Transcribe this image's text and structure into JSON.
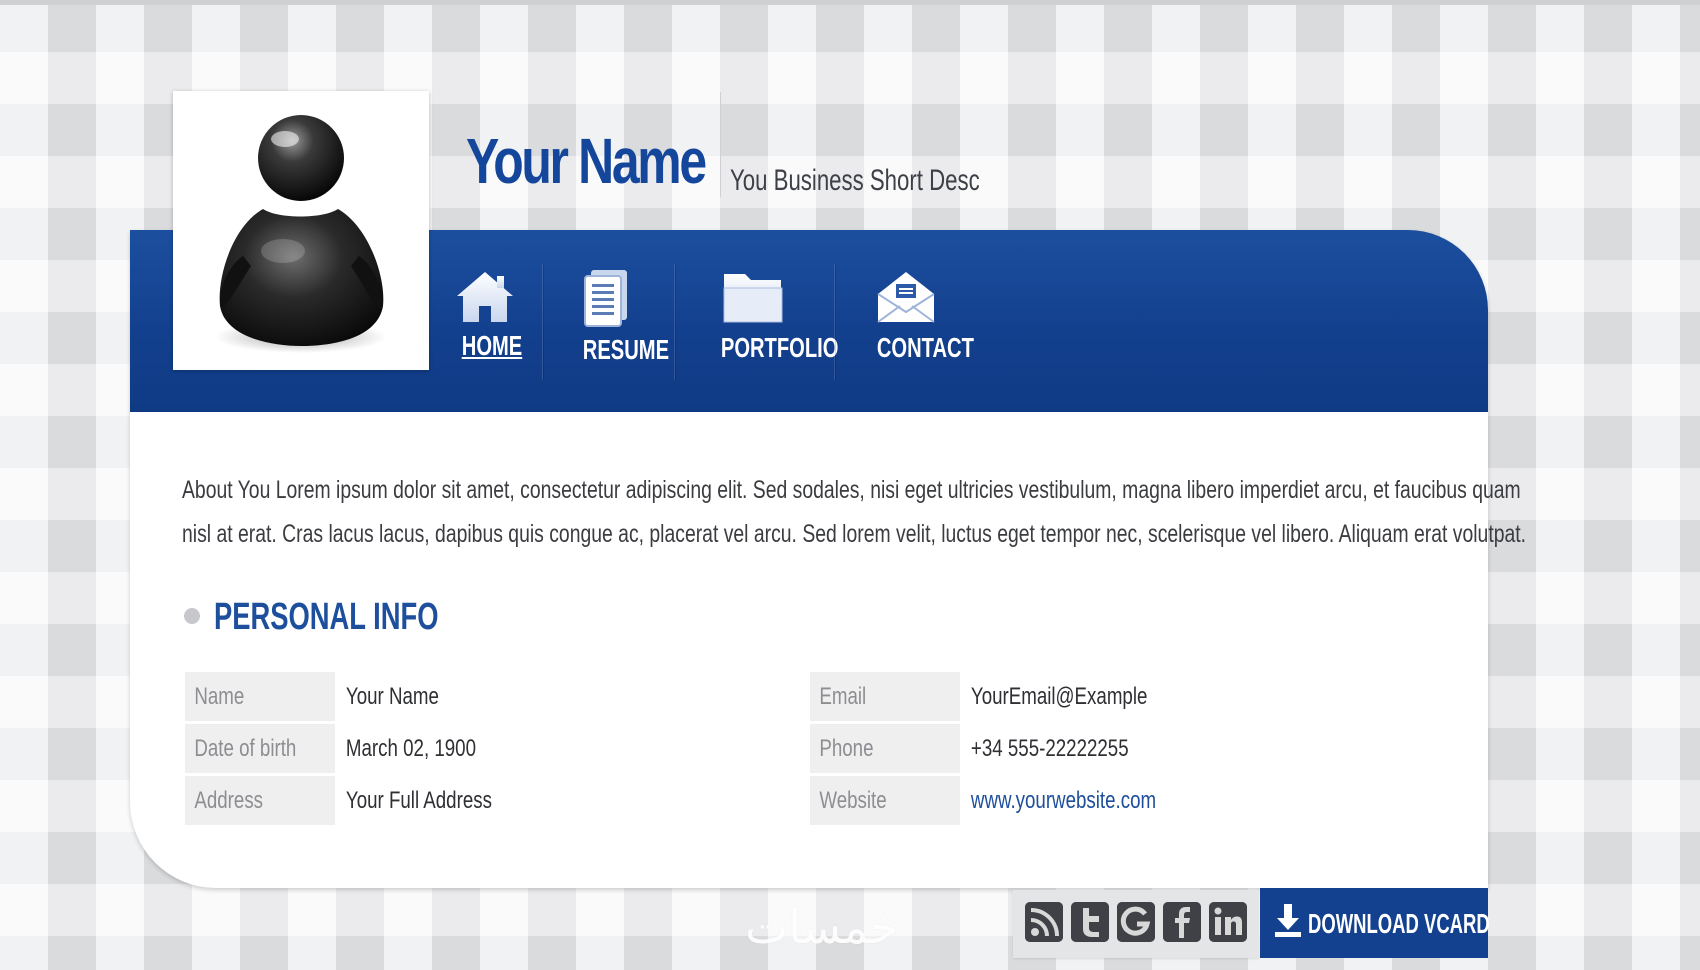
{
  "header": {
    "name": "Your Name",
    "short_desc": "You Business Short Desc"
  },
  "avatar": {
    "icon": "person-silhouette-icon"
  },
  "nav": {
    "items": [
      {
        "label": "HOME",
        "icon": "home-icon",
        "active": true
      },
      {
        "label": "RESUME",
        "icon": "document-icon",
        "active": false
      },
      {
        "label": "PORTFOLIO",
        "icon": "folder-icon",
        "active": false
      },
      {
        "label": "CONTACT",
        "icon": "envelope-icon",
        "active": false
      }
    ]
  },
  "about": {
    "line1": "About You Lorem ipsum dolor sit amet, consectetur adipiscing elit. Sed sodales, nisi eget ultricies vestibulum, magna libero imperdiet arcu, et faucibus quam",
    "line2": "nisl at erat. Cras lacus lacus, dapibus quis congue ac, placerat vel arcu. Sed lorem velit, luctus eget tempor nec, scelerisque vel libero. Aliquam erat volutpat."
  },
  "personal_info": {
    "title": "PERSONAL INFO",
    "left": [
      {
        "label": "Name",
        "value": "Your Name"
      },
      {
        "label": "Date of birth",
        "value": "March 02, 1900"
      },
      {
        "label": "Address",
        "value": "Your Full Address"
      }
    ],
    "right": [
      {
        "label": "Email",
        "value": "YourEmail@Example"
      },
      {
        "label": "Phone",
        "value": "+34 555-22222255"
      },
      {
        "label": "Website",
        "value": "www.yourwebsite.com"
      }
    ]
  },
  "footer": {
    "social": [
      "rss-icon",
      "twitter-icon",
      "google-icon",
      "facebook-icon",
      "linkedin-icon"
    ],
    "download_label": "DOWNLOAD VCARD",
    "download_icon": "download-icon",
    "watermark": "خمسات"
  },
  "colors": {
    "brand_blue": "#14469b",
    "nav_blue": "#13408e",
    "label_bg": "#efefef",
    "link": "#1d4f9c"
  }
}
